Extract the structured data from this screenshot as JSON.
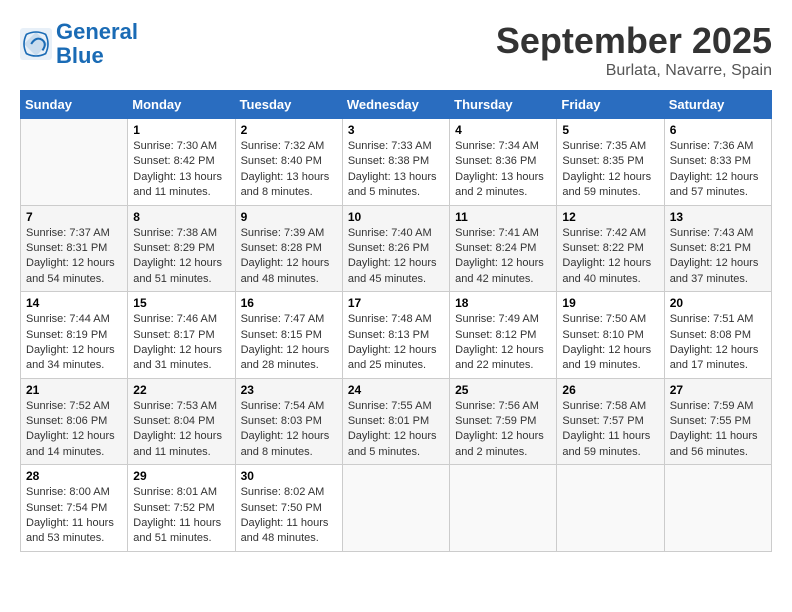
{
  "logo": {
    "line1": "General",
    "line2": "Blue"
  },
  "title": "September 2025",
  "subtitle": "Burlata, Navarre, Spain",
  "days_header": [
    "Sunday",
    "Monday",
    "Tuesday",
    "Wednesday",
    "Thursday",
    "Friday",
    "Saturday"
  ],
  "weeks": [
    [
      {
        "num": "",
        "info": ""
      },
      {
        "num": "1",
        "info": "Sunrise: 7:30 AM\nSunset: 8:42 PM\nDaylight: 13 hours\nand 11 minutes."
      },
      {
        "num": "2",
        "info": "Sunrise: 7:32 AM\nSunset: 8:40 PM\nDaylight: 13 hours\nand 8 minutes."
      },
      {
        "num": "3",
        "info": "Sunrise: 7:33 AM\nSunset: 8:38 PM\nDaylight: 13 hours\nand 5 minutes."
      },
      {
        "num": "4",
        "info": "Sunrise: 7:34 AM\nSunset: 8:36 PM\nDaylight: 13 hours\nand 2 minutes."
      },
      {
        "num": "5",
        "info": "Sunrise: 7:35 AM\nSunset: 8:35 PM\nDaylight: 12 hours\nand 59 minutes."
      },
      {
        "num": "6",
        "info": "Sunrise: 7:36 AM\nSunset: 8:33 PM\nDaylight: 12 hours\nand 57 minutes."
      }
    ],
    [
      {
        "num": "7",
        "info": "Sunrise: 7:37 AM\nSunset: 8:31 PM\nDaylight: 12 hours\nand 54 minutes."
      },
      {
        "num": "8",
        "info": "Sunrise: 7:38 AM\nSunset: 8:29 PM\nDaylight: 12 hours\nand 51 minutes."
      },
      {
        "num": "9",
        "info": "Sunrise: 7:39 AM\nSunset: 8:28 PM\nDaylight: 12 hours\nand 48 minutes."
      },
      {
        "num": "10",
        "info": "Sunrise: 7:40 AM\nSunset: 8:26 PM\nDaylight: 12 hours\nand 45 minutes."
      },
      {
        "num": "11",
        "info": "Sunrise: 7:41 AM\nSunset: 8:24 PM\nDaylight: 12 hours\nand 42 minutes."
      },
      {
        "num": "12",
        "info": "Sunrise: 7:42 AM\nSunset: 8:22 PM\nDaylight: 12 hours\nand 40 minutes."
      },
      {
        "num": "13",
        "info": "Sunrise: 7:43 AM\nSunset: 8:21 PM\nDaylight: 12 hours\nand 37 minutes."
      }
    ],
    [
      {
        "num": "14",
        "info": "Sunrise: 7:44 AM\nSunset: 8:19 PM\nDaylight: 12 hours\nand 34 minutes."
      },
      {
        "num": "15",
        "info": "Sunrise: 7:46 AM\nSunset: 8:17 PM\nDaylight: 12 hours\nand 31 minutes."
      },
      {
        "num": "16",
        "info": "Sunrise: 7:47 AM\nSunset: 8:15 PM\nDaylight: 12 hours\nand 28 minutes."
      },
      {
        "num": "17",
        "info": "Sunrise: 7:48 AM\nSunset: 8:13 PM\nDaylight: 12 hours\nand 25 minutes."
      },
      {
        "num": "18",
        "info": "Sunrise: 7:49 AM\nSunset: 8:12 PM\nDaylight: 12 hours\nand 22 minutes."
      },
      {
        "num": "19",
        "info": "Sunrise: 7:50 AM\nSunset: 8:10 PM\nDaylight: 12 hours\nand 19 minutes."
      },
      {
        "num": "20",
        "info": "Sunrise: 7:51 AM\nSunset: 8:08 PM\nDaylight: 12 hours\nand 17 minutes."
      }
    ],
    [
      {
        "num": "21",
        "info": "Sunrise: 7:52 AM\nSunset: 8:06 PM\nDaylight: 12 hours\nand 14 minutes."
      },
      {
        "num": "22",
        "info": "Sunrise: 7:53 AM\nSunset: 8:04 PM\nDaylight: 12 hours\nand 11 minutes."
      },
      {
        "num": "23",
        "info": "Sunrise: 7:54 AM\nSunset: 8:03 PM\nDaylight: 12 hours\nand 8 minutes."
      },
      {
        "num": "24",
        "info": "Sunrise: 7:55 AM\nSunset: 8:01 PM\nDaylight: 12 hours\nand 5 minutes."
      },
      {
        "num": "25",
        "info": "Sunrise: 7:56 AM\nSunset: 7:59 PM\nDaylight: 12 hours\nand 2 minutes."
      },
      {
        "num": "26",
        "info": "Sunrise: 7:58 AM\nSunset: 7:57 PM\nDaylight: 11 hours\nand 59 minutes."
      },
      {
        "num": "27",
        "info": "Sunrise: 7:59 AM\nSunset: 7:55 PM\nDaylight: 11 hours\nand 56 minutes."
      }
    ],
    [
      {
        "num": "28",
        "info": "Sunrise: 8:00 AM\nSunset: 7:54 PM\nDaylight: 11 hours\nand 53 minutes."
      },
      {
        "num": "29",
        "info": "Sunrise: 8:01 AM\nSunset: 7:52 PM\nDaylight: 11 hours\nand 51 minutes."
      },
      {
        "num": "30",
        "info": "Sunrise: 8:02 AM\nSunset: 7:50 PM\nDaylight: 11 hours\nand 48 minutes."
      },
      {
        "num": "",
        "info": ""
      },
      {
        "num": "",
        "info": ""
      },
      {
        "num": "",
        "info": ""
      },
      {
        "num": "",
        "info": ""
      }
    ]
  ]
}
